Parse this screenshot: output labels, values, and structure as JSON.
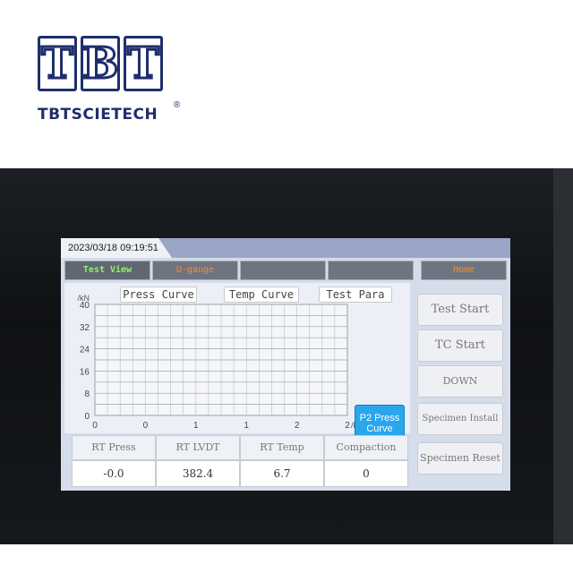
{
  "logo": {
    "letters": [
      "T",
      "B",
      "T"
    ],
    "text": "TBTSCIETECH",
    "registered": "®",
    "color": "#1f2e6b"
  },
  "screen": {
    "datetime": "2023/03/18 09:19:51",
    "tabs": [
      {
        "label": "Test View",
        "color": "#8cf56a"
      },
      {
        "label": "U-gauge",
        "color": "#f58b3a"
      },
      {
        "label": "",
        "color": ""
      },
      {
        "label": "",
        "color": ""
      },
      {
        "label": "Home",
        "color": "#f58b3a"
      }
    ],
    "curve_buttons": [
      "Press Curve",
      "Temp Curve",
      "Test Para"
    ],
    "p2_button": {
      "line1": "P2 Press",
      "line2": "Curve",
      "color": "#2aa6ec"
    },
    "side_buttons": [
      "Test Start",
      "TC Start",
      "DOWN",
      "Specimen Install",
      "Specimen Reset"
    ],
    "readings": {
      "headers": [
        "RT Press",
        "RT LVDT",
        "RT Temp",
        "Compaction"
      ],
      "values": [
        "-0.0",
        "382.4",
        "6.7",
        "0"
      ]
    }
  },
  "chart_data": {
    "type": "line",
    "ylabel": "/kN",
    "xlabel": "/Number",
    "y_ticks": [
      "40",
      "32",
      "24",
      "16",
      "8",
      "0"
    ],
    "x_ticks": [
      "0",
      "0",
      "1",
      "1",
      "2",
      "2"
    ],
    "ylim": [
      0,
      40
    ],
    "grid": true,
    "series": []
  }
}
